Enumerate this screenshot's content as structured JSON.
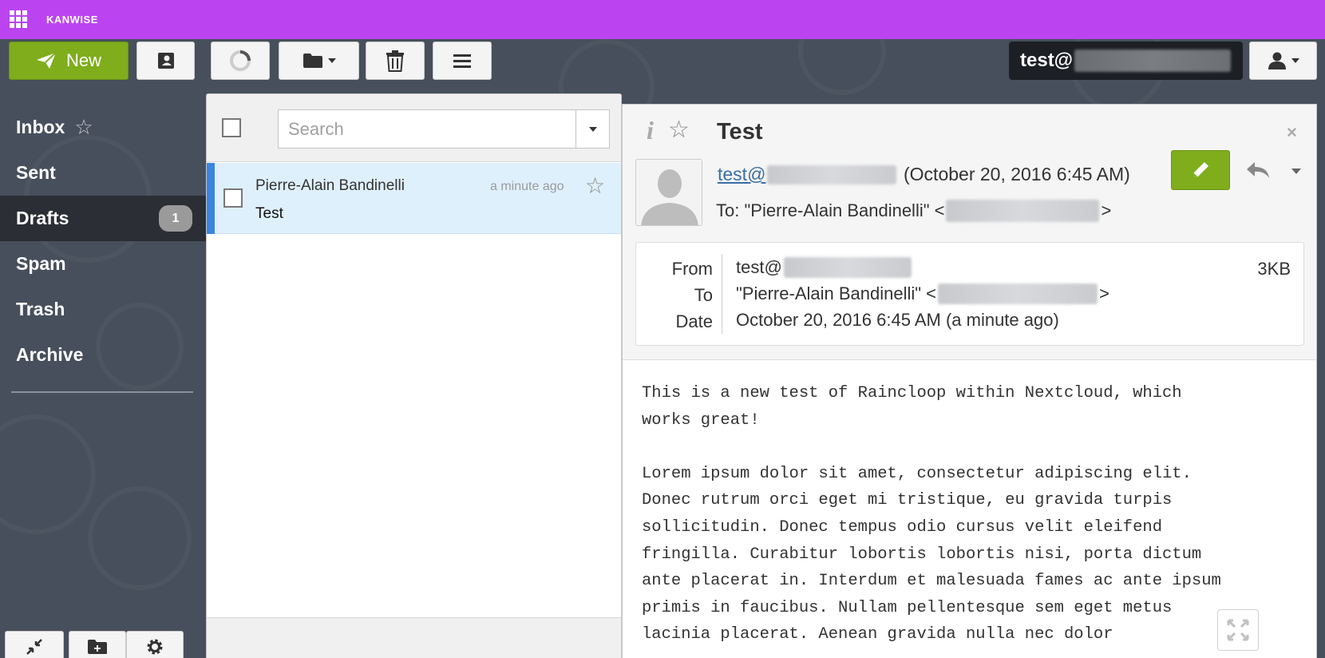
{
  "topbar": {
    "brand": "KANWISE",
    "color": "#bb44f0"
  },
  "toolbar": {
    "new_label": "New",
    "account_prefix": "test@"
  },
  "sidebar": {
    "folders": [
      {
        "label": "Inbox"
      },
      {
        "label": "Sent"
      },
      {
        "label": "Drafts",
        "count": "1"
      },
      {
        "label": "Spam"
      },
      {
        "label": "Trash"
      },
      {
        "label": "Archive"
      }
    ]
  },
  "list": {
    "search_placeholder": "Search",
    "messages": [
      {
        "sender": "Pierre-Alain Bandinelli",
        "time": "a minute ago",
        "subject": "Test"
      }
    ]
  },
  "view": {
    "subject": "Test",
    "close": "×",
    "from_prefix": "test@",
    "date": "(October 20, 2016 6:45 AM)",
    "to_prefix": "To: \"Pierre-Alain Bandinelli\" <",
    "to_suffix": ">",
    "details": {
      "from_label": "From",
      "to_label": "To",
      "date_label": "Date",
      "from_value": "test@",
      "to_value": "\"Pierre-Alain Bandinelli\" <",
      "to_suffix": ">",
      "date_value": "October 20, 2016 6:45 AM (a minute ago)",
      "size": "3KB"
    },
    "body": "This is a new test of Raincloop within Nextcloud, which\nworks great!\n\nLorem ipsum dolor sit amet, consectetur adipiscing elit.\nDonec rutrum orci eget mi tristique, eu gravida turpis\nsollicitudin. Donec tempus odio cursus velit eleifend\nfringilla. Curabitur lobortis lobortis nisi, porta dictum\nante placerat in. Interdum et malesuada fames ac ante ipsum\nprimis in faucibus. Nullam pellentesque sem eget metus\nlacinia placerat. Aenean gravida nulla nec dolor"
  }
}
